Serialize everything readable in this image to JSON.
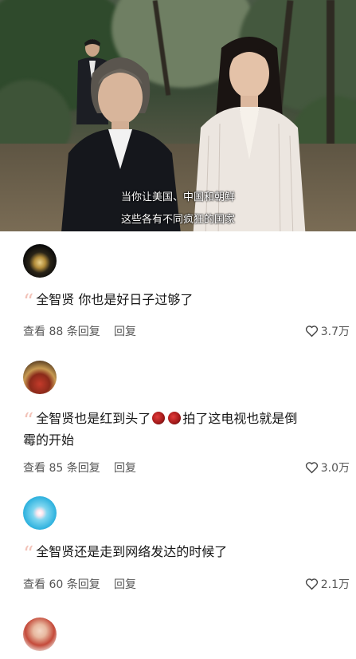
{
  "video": {
    "subtitle_line1": "当你让美国、中国和朝鲜",
    "subtitle_line2": "这些各有不同疯狂的国家"
  },
  "comments": [
    {
      "text": "全智贤 你也是好日子过够了",
      "replies": "查看 88 条回复",
      "reply_label": "回复",
      "likes": "3.7万"
    },
    {
      "text_part1": "全智贤也是红到头了",
      "text_part2": "拍了这电视也就是倒",
      "text_line2": "霉的开始",
      "replies": "查看 85 条回复",
      "reply_label": "回复",
      "likes": "3.0万"
    },
    {
      "text": "全智贤还是走到网络发达的时候了",
      "replies": "查看 60 条回复",
      "reply_label": "回复",
      "likes": "2.1万"
    }
  ],
  "icons": {
    "quote": "quote-icon",
    "like": "heart-outline-icon",
    "emoji": "fire-heart-emoji"
  },
  "colors": {
    "quote": "#f2c2b8",
    "meta_text": "#555555",
    "body_text": "#161616"
  }
}
